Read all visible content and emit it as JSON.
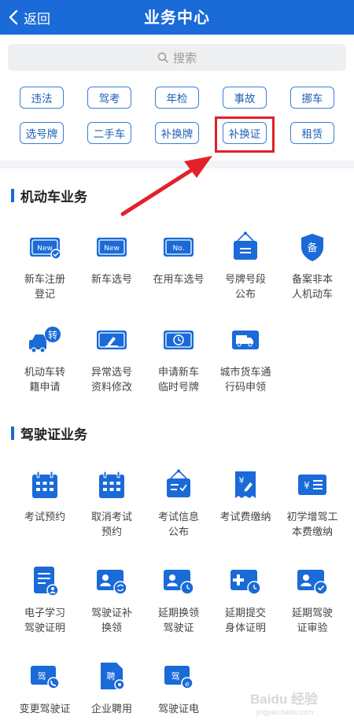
{
  "header": {
    "back_label": "返回",
    "title": "业务中心"
  },
  "search": {
    "placeholder": "搜索"
  },
  "quick_buttons": [
    "违法",
    "驾考",
    "年检",
    "事故",
    "挪车",
    "选号牌",
    "二手车",
    "补换牌",
    "补换证",
    "租赁"
  ],
  "highlighted_button": "补换证",
  "motor": {
    "title": "机动车业务",
    "items": [
      "新车注册\n登记",
      "新车选号",
      "在用车选号",
      "号牌号段\n公布",
      "备案非本\n人机动车",
      "机动车转\n籍申请",
      "异常选号\n资料修改",
      "申请新车\n临时号牌",
      "城市货车通\n行码申领"
    ]
  },
  "license": {
    "title": "驾驶证业务",
    "items": [
      "考试预约",
      "取消考试\n预约",
      "考试信息\n公布",
      "考试费缴纳",
      "初学增驾工\n本费缴纳",
      "电子学习\n驾驶证明",
      "驾驶证补\n换领",
      "延期换领\n驾驶证",
      "延期提交\n身体证明",
      "延期驾驶\n证审验",
      "变更驾驶证",
      "企业聘用",
      "驾驶证电"
    ]
  },
  "icon_labels": {
    "new_plate": "New",
    "no_plate": "No.",
    "bei": "备",
    "zhuan": "转",
    "jia": "驾",
    "pin": "聘"
  },
  "colors": {
    "primary": "#1a6ad8",
    "highlight": "#e0212a"
  },
  "watermark": {
    "text": "Baidu 经验",
    "subtext": "jingyan.baidu.com"
  }
}
